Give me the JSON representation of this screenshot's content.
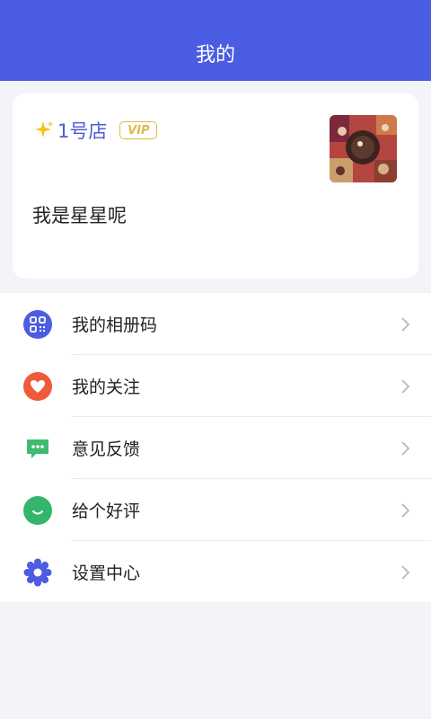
{
  "header": {
    "title": "我的"
  },
  "profile": {
    "store_name": "1号店",
    "vip_label": "VIP",
    "nickname": "我是星星呢"
  },
  "menu": {
    "items": [
      {
        "label": "我的相册码",
        "icon": "qr-code-icon",
        "color": "#4c5de0"
      },
      {
        "label": "我的关注",
        "icon": "heart-icon",
        "color": "#f05a3b"
      },
      {
        "label": "意见反馈",
        "icon": "chat-bubble-icon",
        "color": "#3dbb6f"
      },
      {
        "label": "给个好评",
        "icon": "smile-icon",
        "color": "#33b66b"
      },
      {
        "label": "设置中心",
        "icon": "gear-icon",
        "color": "#4c5de0"
      }
    ]
  },
  "colors": {
    "header_bg": "#4a5ce2",
    "accent": "#4b5bd6",
    "vip_gold": "#e0b94a"
  }
}
